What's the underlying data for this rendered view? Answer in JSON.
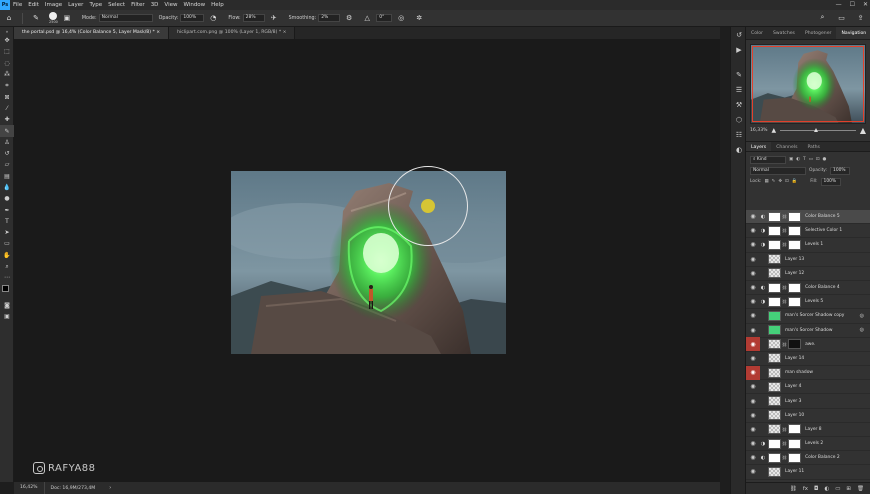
{
  "menu": [
    "File",
    "Edit",
    "Image",
    "Layer",
    "Type",
    "Select",
    "Filter",
    "3D",
    "View",
    "Window",
    "Help"
  ],
  "options": {
    "brush_size": "2500",
    "mode_label": "Mode:",
    "mode_value": "Normal",
    "opacity_label": "Opacity:",
    "opacity_value": "100%",
    "flow_label": "Flow:",
    "flow_value": "28%",
    "smoothing_label": "Smoothing:",
    "smoothing_value": "2%",
    "angle_value": "0°"
  },
  "tabs": [
    {
      "label": "the portal.psd @ 16,4% (Color Balance 5, Layer Mask/8) *",
      "active": true
    },
    {
      "label": "hiclipart.com.png @ 100% (Layer 1, RGB/8) *",
      "active": false
    }
  ],
  "status": {
    "zoom": "16,42%",
    "doc": "Doc: 16,9M/273,4M"
  },
  "watermark": "RAFYA88",
  "panels": {
    "top_tabs": [
      "Color",
      "Swatches",
      "Photogener",
      "Navigation"
    ],
    "active_top_tab": "Navigation",
    "nav_zoom": "16,33%",
    "layer_tabs": [
      "Layers",
      "Channels",
      "Paths"
    ],
    "kind_label": "Kind",
    "blend_mode": "Normal",
    "opacity_label": "Opacity:",
    "opacity_value": "100%",
    "lock_label": "Lock:",
    "fill_label": "Fill:",
    "fill_value": "100%"
  },
  "layers": [
    {
      "name": "Color Balance 5",
      "thumb": "white",
      "adj": "◐",
      "mask": true,
      "selected": true
    },
    {
      "name": "Selective Color 1",
      "thumb": "white",
      "adj": "◑",
      "mask": true
    },
    {
      "name": "Levels 1",
      "thumb": "white",
      "adj": "◑",
      "mask": true
    },
    {
      "name": "Layer 13",
      "thumb": "check"
    },
    {
      "name": "Layer 12",
      "thumb": "check"
    },
    {
      "name": "Color Balance 4",
      "thumb": "white",
      "adj": "◐",
      "mask": true
    },
    {
      "name": "Levels 5",
      "thumb": "white",
      "adj": "◑",
      "mask": true
    },
    {
      "name": "man's Sorcer Shadow copy",
      "thumb": "green",
      "fx": true
    },
    {
      "name": "man's Sorcer Shadow",
      "thumb": "green",
      "fx": true
    },
    {
      "name": "awe.",
      "thumb": "check",
      "mask_black": true,
      "eye_red": true
    },
    {
      "name": "Layer 14",
      "thumb": "check"
    },
    {
      "name": "man shadow",
      "thumb": "check",
      "eye_red": true
    },
    {
      "name": "Layer 4",
      "thumb": "check"
    },
    {
      "name": "Layer 3",
      "thumb": "check"
    },
    {
      "name": "Layer 10",
      "thumb": "check"
    },
    {
      "name": "Layer 8",
      "thumb": "check",
      "mask": true
    },
    {
      "name": "Levels 2",
      "thumb": "white",
      "adj": "◑",
      "mask": true
    },
    {
      "name": "Color Balance 2",
      "thumb": "white",
      "adj": "◐",
      "mask": true
    },
    {
      "name": "Layer 11",
      "thumb": "check"
    }
  ]
}
